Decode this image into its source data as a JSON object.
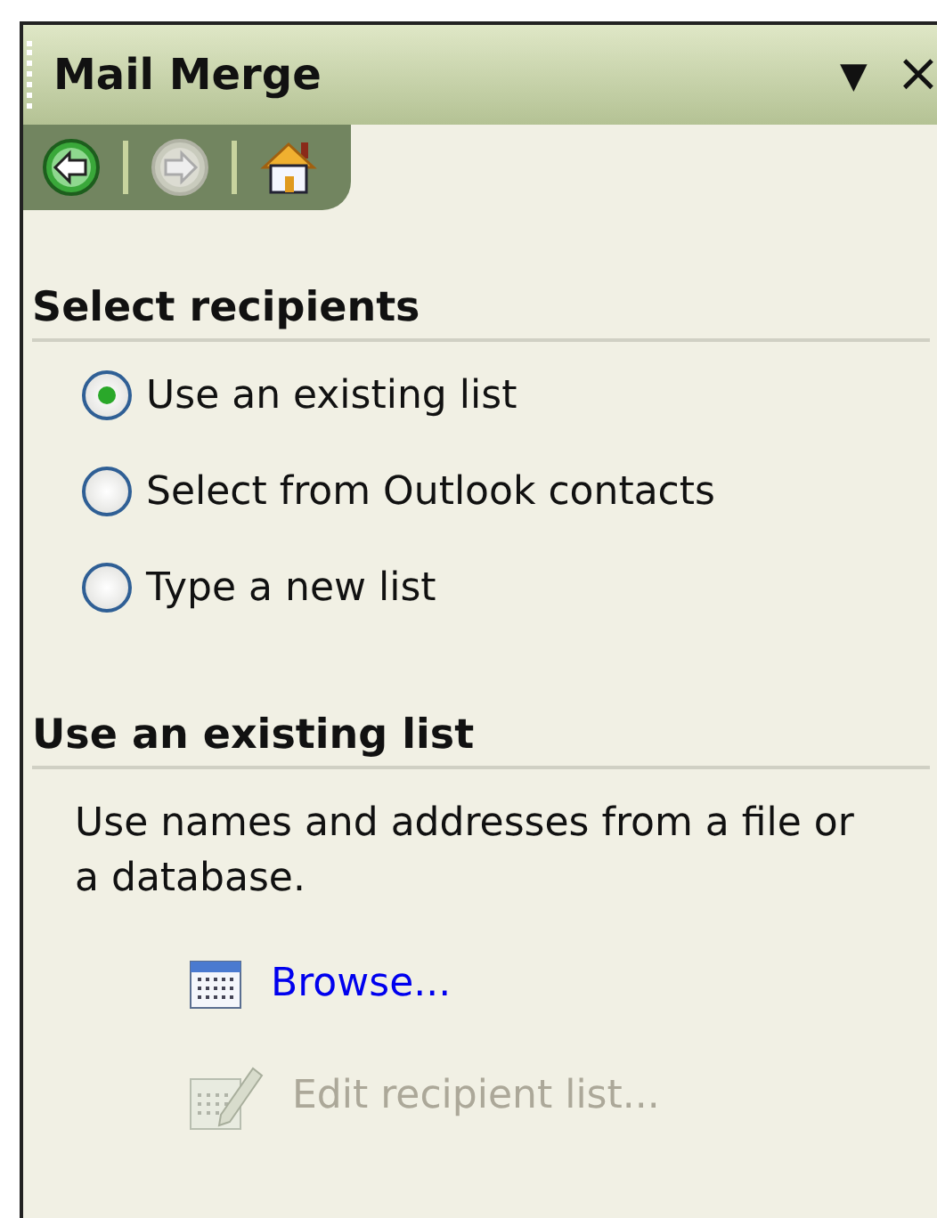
{
  "panel": {
    "title": "Mail Merge",
    "menu_glyph": "▼",
    "close_glyph": "×"
  },
  "nav": [
    {
      "kind": "back",
      "disabled": false
    },
    {
      "kind": "forward",
      "disabled": true
    },
    {
      "kind": "home",
      "disabled": false
    }
  ],
  "sections": [
    {
      "heading": "Select recipients",
      "options": [
        {
          "label": "Use an existing list",
          "selected": true
        },
        {
          "label": "Select from Outlook contacts",
          "selected": false
        },
        {
          "label": "Type a new list",
          "selected": false
        }
      ]
    },
    {
      "heading": "Use an existing list",
      "text": "Use names and addresses from a file or a database.",
      "links": [
        {
          "label": "Browse...",
          "kind": "browse",
          "disabled": false
        },
        {
          "label": "Edit recipient list...",
          "kind": "edit",
          "disabled": true
        }
      ]
    }
  ]
}
